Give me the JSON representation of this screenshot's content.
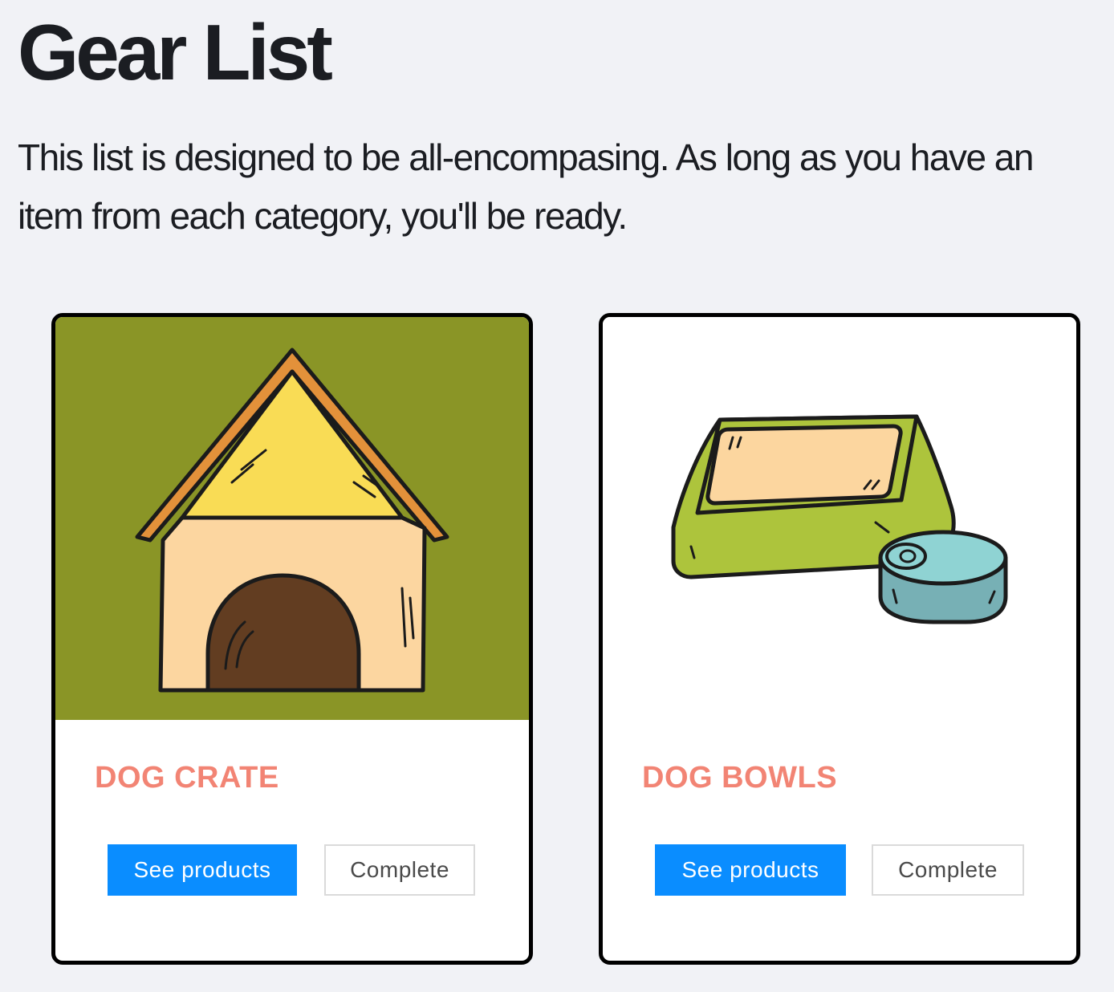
{
  "page": {
    "title": "Gear List",
    "intro": "This list is designed to be all-encompasing. As long as you have an item from each category, you'll be ready."
  },
  "cards": [
    {
      "title": "DOG CRATE",
      "image": "doghouse-illustration",
      "image_background": "#8a9526",
      "primary_label": "See products",
      "secondary_label": "Complete"
    },
    {
      "title": "DOG BOWLS",
      "image": "dog-bowl-and-can-illustration",
      "image_background": "#ffffff",
      "primary_label": "See products",
      "secondary_label": "Complete"
    }
  ],
  "colors": {
    "page_background": "#f1f2f6",
    "card_title": "#f28474",
    "primary_button": "#0a8dff",
    "secondary_button_border": "#dadada"
  }
}
